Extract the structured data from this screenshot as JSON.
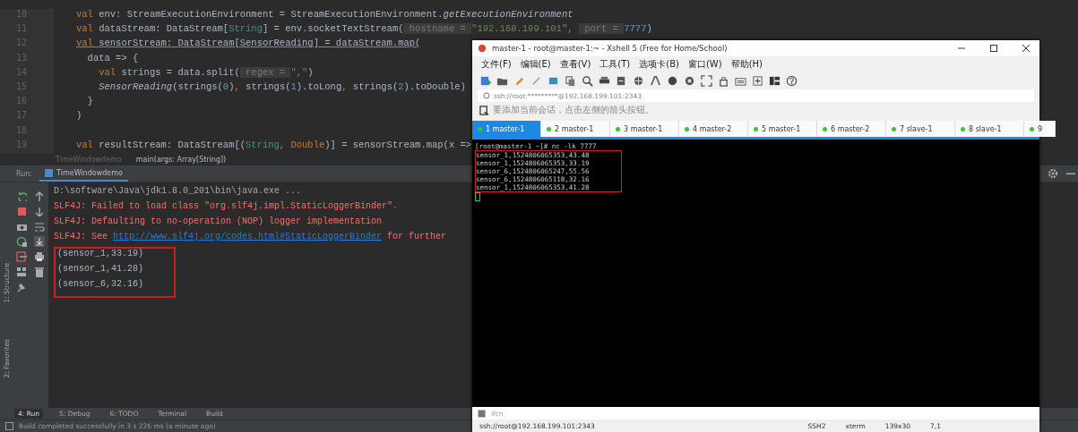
{
  "editor": {
    "lines": [
      {
        "number": "10",
        "underline": false,
        "tokens": [
          {
            "kind": "keyword",
            "text": "val"
          },
          {
            "kind": "plain",
            "text": " env: StreamExecutionEnvironment = StreamExecutionEnvironment."
          },
          {
            "kind": "italic",
            "text": "getExecutionEnvironment"
          }
        ]
      },
      {
        "number": "11",
        "underline": false,
        "tokens": [
          {
            "kind": "keyword",
            "text": "val"
          },
          {
            "kind": "plain",
            "text": " dataStream: DataStream["
          },
          {
            "kind": "type",
            "text": "String"
          },
          {
            "kind": "plain",
            "text": "] = env.socketTextStream("
          },
          {
            "kind": "hint",
            "text": " hostname = "
          },
          {
            "kind": "string",
            "text": "\"192.168.199.101\""
          },
          {
            "kind": "keyword",
            "text": ", "
          },
          {
            "kind": "hint",
            "text": " port = "
          },
          {
            "kind": "number",
            "text": "7777"
          },
          {
            "kind": "plain",
            "text": ")"
          }
        ]
      },
      {
        "number": "12",
        "underline": true,
        "tokens": [
          {
            "kind": "keyword",
            "text": "val"
          },
          {
            "kind": "plain",
            "text": " sensorStream: DataStream[SensorReading] = dataStream.map("
          }
        ]
      },
      {
        "number": "13",
        "underline": false,
        "tokens": [
          {
            "kind": "plain",
            "text": "  data => {"
          }
        ]
      },
      {
        "number": "14",
        "underline": false,
        "tokens": [
          {
            "kind": "keyword",
            "text": "    val"
          },
          {
            "kind": "plain",
            "text": " strings = data.split("
          },
          {
            "kind": "hint",
            "text": " regex = "
          },
          {
            "kind": "string",
            "text": "\",\""
          },
          {
            "kind": "plain",
            "text": ")"
          }
        ]
      },
      {
        "number": "15",
        "underline": false,
        "tokens": [
          {
            "kind": "italic",
            "text": "    SensorReading"
          },
          {
            "kind": "plain",
            "text": "(strings("
          },
          {
            "kind": "number",
            "text": "0"
          },
          {
            "kind": "plain",
            "text": ")"
          },
          {
            "kind": "keyword",
            "text": ", "
          },
          {
            "kind": "plain",
            "text": "strings("
          },
          {
            "kind": "number",
            "text": "1"
          },
          {
            "kind": "plain",
            "text": ").toLong"
          },
          {
            "kind": "keyword",
            "text": ", "
          },
          {
            "kind": "plain",
            "text": "strings("
          },
          {
            "kind": "number",
            "text": "2"
          },
          {
            "kind": "plain",
            "text": ").toDouble)"
          }
        ]
      },
      {
        "number": "16",
        "underline": false,
        "tokens": [
          {
            "kind": "plain",
            "text": "  }"
          }
        ]
      },
      {
        "number": "17",
        "underline": false,
        "tokens": [
          {
            "kind": "plain",
            "text": ")"
          }
        ]
      },
      {
        "number": "18"
      },
      {
        "number": "19",
        "underline": false,
        "tokens": [
          {
            "kind": "keyword",
            "text": "val"
          },
          {
            "kind": "plain",
            "text": " resultStream: DataStream[("
          },
          {
            "kind": "type",
            "text": "String"
          },
          {
            "kind": "keyword",
            "text": ", "
          },
          {
            "kind": "keyword",
            "text": "Double"
          },
          {
            "kind": "plain",
            "text": ")] = sensorStream.map(x =>"
          }
        ]
      }
    ],
    "breadcrumb": [
      "TimeWindowdemo",
      "main(args: Array[String])"
    ]
  },
  "run_panel": {
    "label": "Run:",
    "tab": "TimeWindowdemo",
    "console": [
      {
        "kind": "command",
        "text": "D:\\software\\Java\\jdk1.8.0_201\\bin\\java.exe ..."
      },
      {
        "kind": "error",
        "text": "SLF4J: Failed to load class \"org.slf4j.impl.StaticLoggerBinder\"."
      },
      {
        "kind": "error",
        "text": "SLF4J: Defaulting to no-operation (NOP) logger implementation"
      },
      {
        "kind": "error",
        "text": "SLF4J: See ",
        "link": "http://www.slf4j.org/codes.html#StaticLoggerBinder",
        "after": " for further"
      }
    ],
    "highlighted_output": [
      "(sensor_1,33.19)",
      "(sensor_1,41.28)",
      "(sensor_6,32.16)"
    ]
  },
  "side_tabs": [
    "1: Structure",
    "2: Favorites"
  ],
  "tool_tabs": [
    {
      "label": "4: Run",
      "selected": true
    },
    {
      "label": "5: Debug",
      "selected": false
    },
    {
      "label": "6: TODO",
      "selected": false
    },
    {
      "label": "Terminal",
      "selected": false
    },
    {
      "label": "Build",
      "selected": false
    }
  ],
  "status_bar": "Build completed successfully in 3 s 226 ms (a minute ago)",
  "xshell": {
    "title": "master-1 - root@master-1:~ - Xshell 5 (Free for Home/School)",
    "menu": [
      "文件(F)",
      "编辑(E)",
      "查看(V)",
      "工具(T)",
      "选项卡(B)",
      "窗口(W)",
      "帮助(H)"
    ],
    "address": "ssh://root:*********@192.168.199.101:2343",
    "hint": "要添加当前会话，点击左侧的箭头按钮。",
    "tabs": [
      {
        "label": "1 master-1",
        "selected": true
      },
      {
        "label": "2 master-1",
        "selected": false
      },
      {
        "label": "3 master-1",
        "selected": false
      },
      {
        "label": "4 master-2",
        "selected": false
      },
      {
        "label": "5 master-1",
        "selected": false
      },
      {
        "label": "6 master-2",
        "selected": false
      },
      {
        "label": "7 slave-1",
        "selected": false
      },
      {
        "label": "8 slave-1",
        "selected": false
      },
      {
        "label": "9",
        "selected": false
      }
    ],
    "prompt": "[root@master-1 ~]# nc -lk 7777",
    "highlighted_lines": [
      "sensor_1,1524806065353,43.48",
      "sensor_1,1524806065353,33.19",
      "sensor_6,1524806065247,55.56",
      "sensor_6,1524806065118,32.16",
      "sensor_1,1524806065353,41.28"
    ],
    "input_bar": "ifcn",
    "status": {
      "connection": "ssh://root@192.168.199.101:2343",
      "items": [
        "SSH2",
        "xterm",
        "139x30",
        "7,1"
      ]
    }
  }
}
